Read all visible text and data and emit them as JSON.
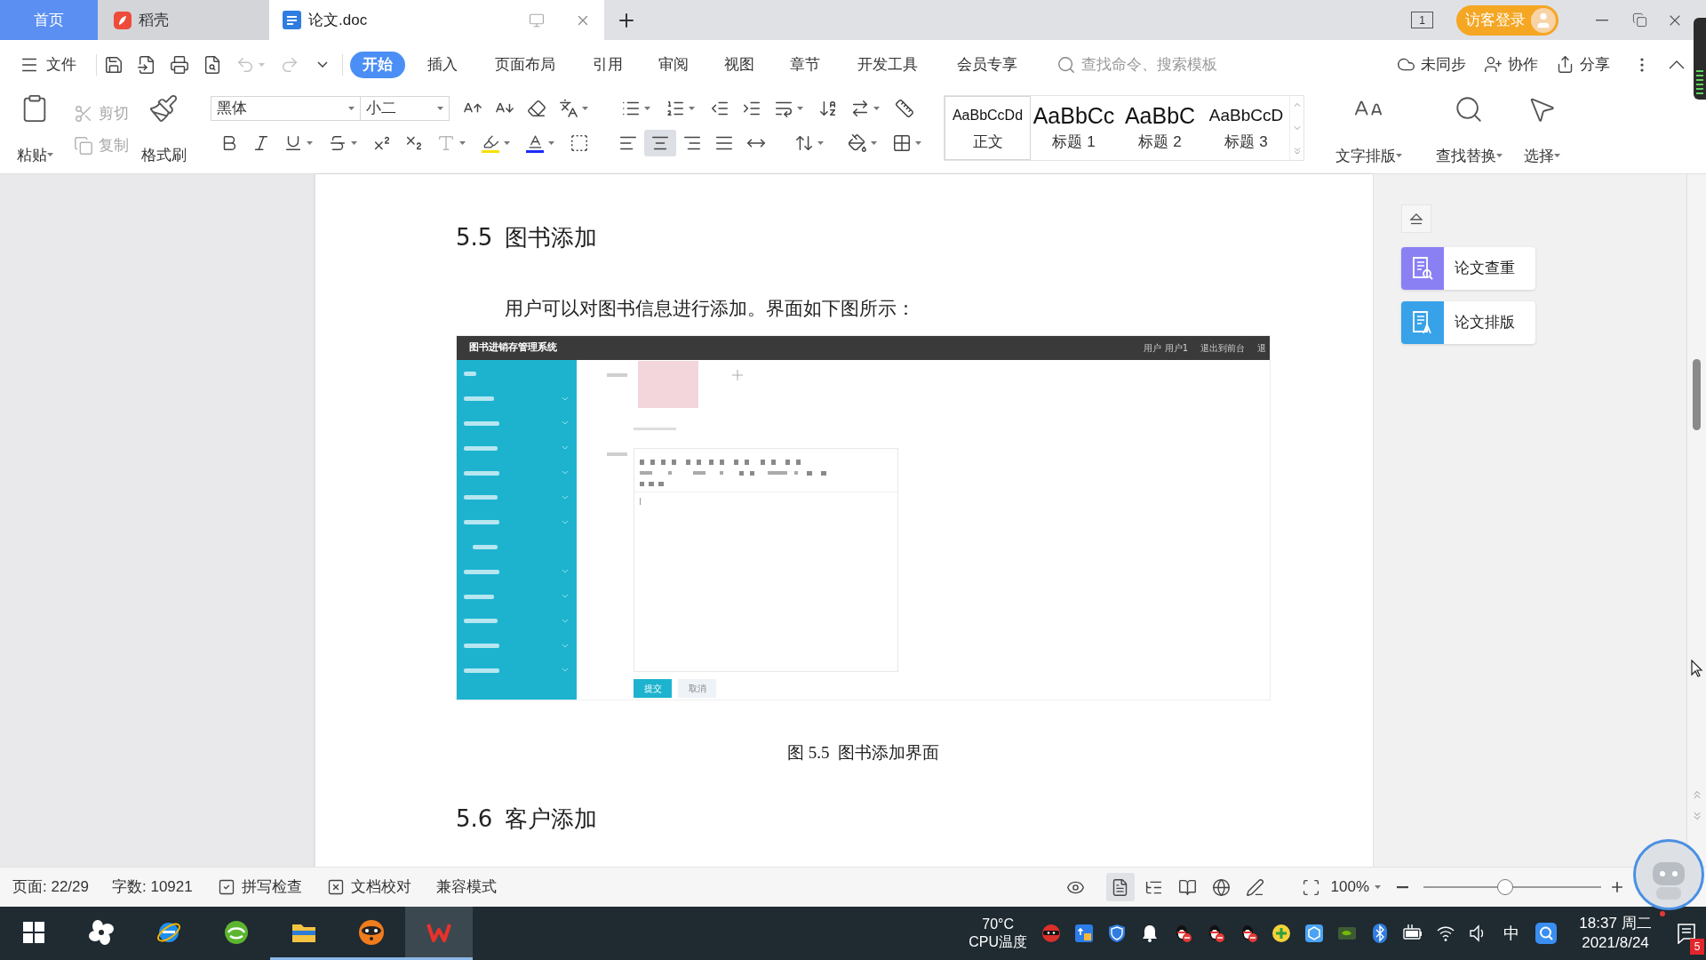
{
  "tabs": [
    {
      "label": "首页",
      "kind": "home",
      "selected": false
    },
    {
      "label": "稻壳",
      "kind": "docer",
      "selected": false
    },
    {
      "label": "论文.doc",
      "kind": "document",
      "selected": true
    }
  ],
  "title_bar": {
    "window_count": "1",
    "account": "访客登录"
  },
  "menu": {
    "file": "文件",
    "quick_access": [
      {
        "kind": "save",
        "disabled": false
      },
      {
        "kind": "export",
        "disabled": false
      },
      {
        "kind": "print",
        "disabled": false
      },
      {
        "kind": "preview",
        "disabled": false
      },
      {
        "kind": "undo",
        "disabled": true
      },
      {
        "kind": "redo",
        "disabled": true
      }
    ],
    "tabs": [
      {
        "label": "开始",
        "selected": true
      },
      {
        "label": "插入",
        "selected": false
      },
      {
        "label": "页面布局",
        "selected": false
      },
      {
        "label": "引用",
        "selected": false
      },
      {
        "label": "审阅",
        "selected": false
      },
      {
        "label": "视图",
        "selected": false
      },
      {
        "label": "章节",
        "selected": false
      },
      {
        "label": "开发工具",
        "selected": false
      },
      {
        "label": "会员专享",
        "selected": false
      }
    ],
    "search": {
      "placeholder": "查找命令、搜索模板"
    },
    "actions": [
      {
        "label": "未同步",
        "kind": "sync"
      },
      {
        "label": "协作",
        "kind": "collaborate"
      },
      {
        "label": "分享",
        "kind": "share"
      }
    ]
  },
  "ribbon": {
    "paste": "粘贴",
    "edit": [
      {
        "label": "剪切",
        "kind": "cut",
        "disabled": true
      },
      {
        "label": "复制",
        "kind": "copy",
        "disabled": true
      }
    ],
    "format_painter": "格式刷",
    "font": {
      "family": "黑体",
      "size": "小二"
    },
    "alignment": [
      {
        "kind": "left",
        "selected": false
      },
      {
        "kind": "center",
        "selected": true
      },
      {
        "kind": "right",
        "selected": false
      },
      {
        "kind": "justify",
        "selected": false
      },
      {
        "kind": "distributed",
        "selected": false
      }
    ],
    "styles": [
      {
        "preview": "AaBbCcDd",
        "label": "正文",
        "kind": "body",
        "selected": true
      },
      {
        "preview": "AaBbCc",
        "label": "标题 1",
        "kind": "heading1",
        "selected": false
      },
      {
        "preview": "AaBbC",
        "label": "标题 2",
        "kind": "heading2",
        "selected": false
      },
      {
        "preview": "AaBbCcD",
        "label": "标题 3",
        "kind": "heading3",
        "selected": false
      }
    ],
    "tools": [
      {
        "label": "文字排版",
        "kind": "text-layout"
      },
      {
        "label": "查找替换",
        "kind": "find-replace"
      },
      {
        "label": "选择",
        "kind": "select"
      }
    ]
  },
  "document": {
    "blocks": [
      {
        "kind": "heading",
        "number": "5.5",
        "text": "图书添加"
      },
      {
        "kind": "paragraph",
        "text": "用户可以对图书信息进行添加。界面如下图所示："
      },
      {
        "kind": "figure",
        "title": "图书进销存管理系统",
        "header_links": [
          "用户 用户1",
          "退出到前台",
          "退"
        ],
        "buttons": [
          {
            "label": "提交",
            "primary": true
          },
          {
            "label": "取消",
            "primary": false
          }
        ]
      },
      {
        "kind": "caption",
        "text": "图 5.5  图书添加界面"
      },
      {
        "kind": "heading",
        "number": "5.6",
        "text": "客户添加"
      }
    ]
  },
  "side_panel": {
    "items": [
      {
        "label": "论文查重",
        "kind": "check",
        "color": "#8a80f4"
      },
      {
        "label": "论文排版",
        "kind": "format",
        "color": "#38a2e8"
      }
    ]
  },
  "status_bar": {
    "page": "页面: 22/29",
    "words": "字数: 10921",
    "tools": [
      {
        "label": "拼写检查",
        "kind": "spell"
      },
      {
        "label": "文档校对",
        "kind": "proofread"
      }
    ],
    "mode": "兼容模式",
    "views": [
      {
        "kind": "eye",
        "selected": false
      },
      {
        "kind": "page",
        "selected": true
      },
      {
        "kind": "outline",
        "selected": false
      },
      {
        "kind": "read",
        "selected": false
      },
      {
        "kind": "web",
        "selected": false
      },
      {
        "kind": "write",
        "selected": false
      }
    ],
    "zoom": "100%",
    "zoom_slider": {
      "level": 0.46
    }
  },
  "taskbar": {
    "apps": [
      {
        "kind": "start",
        "running": false,
        "selected": false
      },
      {
        "kind": "pinwheel",
        "running": false,
        "selected": false
      },
      {
        "kind": "ie",
        "running": false,
        "selected": false
      },
      {
        "kind": "browser",
        "running": false,
        "selected": false
      },
      {
        "kind": "folder",
        "running": true,
        "selected": false
      },
      {
        "kind": "raccoon",
        "running": true,
        "selected": false
      },
      {
        "kind": "wps",
        "running": true,
        "selected": true
      }
    ],
    "cpu": {
      "temperature": "70°C",
      "label": "CPU温度"
    },
    "tray": [
      {
        "kind": "raccoon"
      },
      {
        "kind": "upload"
      },
      {
        "kind": "shield"
      },
      {
        "kind": "bell"
      },
      {
        "kind": "penguin"
      },
      {
        "kind": "penguin"
      },
      {
        "kind": "penguin"
      },
      {
        "kind": "plus"
      },
      {
        "kind": "hexagon"
      },
      {
        "kind": "chip"
      },
      {
        "kind": "bluetooth"
      },
      {
        "kind": "battery"
      },
      {
        "kind": "wifi"
      },
      {
        "kind": "volume"
      }
    ],
    "ime": "中",
    "time": "18:37 周二",
    "date": "2021/8/24",
    "notifications": "5"
  }
}
